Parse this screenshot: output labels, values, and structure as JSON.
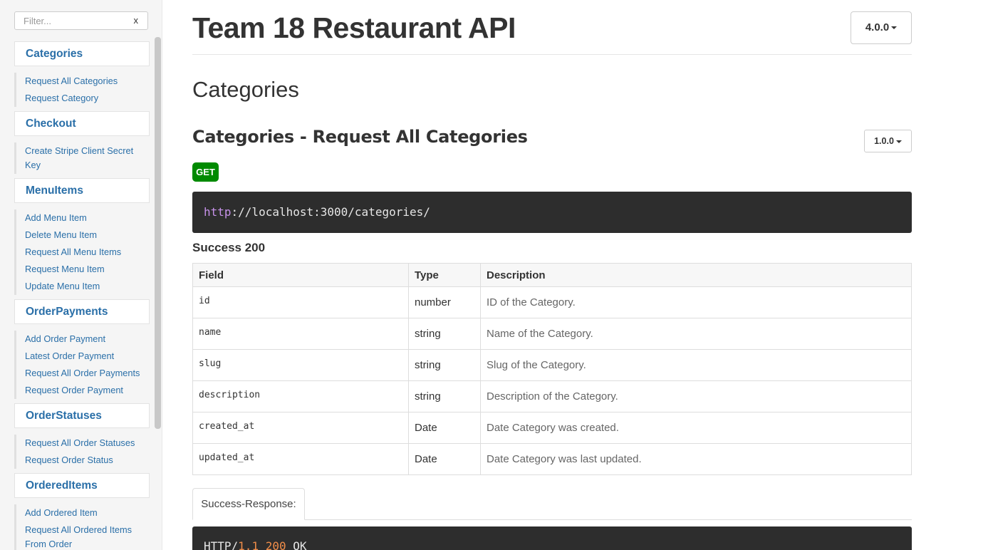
{
  "filter": {
    "placeholder": "Filter...",
    "clear_label": "x"
  },
  "sidebar": {
    "groups": [
      {
        "title": "Categories",
        "items": [
          "Request All Categories",
          "Request Category"
        ]
      },
      {
        "title": "Checkout",
        "items": [
          "Create Stripe Client Secret Key"
        ]
      },
      {
        "title": "MenuItems",
        "items": [
          "Add Menu Item",
          "Delete Menu Item",
          "Request All Menu Items",
          "Request Menu Item",
          "Update Menu Item"
        ]
      },
      {
        "title": "OrderPayments",
        "items": [
          "Add Order Payment",
          "Latest Order Payment",
          "Request All Order Payments",
          "Request Order Payment"
        ]
      },
      {
        "title": "OrderStatuses",
        "items": [
          "Request All Order Statuses",
          "Request Order Status"
        ]
      },
      {
        "title": "OrderedItems",
        "items": [
          "Add Ordered Item",
          "Request All Ordered Items From Order"
        ]
      }
    ]
  },
  "header": {
    "title": "Team 18 Restaurant API",
    "version": "4.0.0"
  },
  "section": {
    "title": "Categories"
  },
  "endpoint": {
    "title": "Categories - Request All Categories",
    "version": "1.0.0",
    "method": "GET",
    "url_scheme": "http",
    "url_rest": "://localhost:3000/categories/",
    "success_label": "Success 200",
    "columns": {
      "field": "Field",
      "type": "Type",
      "description": "Description"
    },
    "fields": [
      {
        "field": "id",
        "type": "number",
        "description": "ID of the Category."
      },
      {
        "field": "name",
        "type": "string",
        "description": "Name of the Category."
      },
      {
        "field": "slug",
        "type": "string",
        "description": "Slug of the Category."
      },
      {
        "field": "description",
        "type": "string",
        "description": "Description of the Category."
      },
      {
        "field": "created_at",
        "type": "Date",
        "description": "Date Category was created."
      },
      {
        "field": "updated_at",
        "type": "Date",
        "description": "Date Category was last updated."
      }
    ],
    "response_tab": "Success-Response:",
    "response": {
      "protocol": "HTTP/",
      "version": "1.1",
      "status": "200",
      "text": "OK"
    }
  },
  "colors": {
    "link": "#2a6fa8",
    "method_get": "#008a00",
    "code_bg": "#2d2d2d"
  }
}
